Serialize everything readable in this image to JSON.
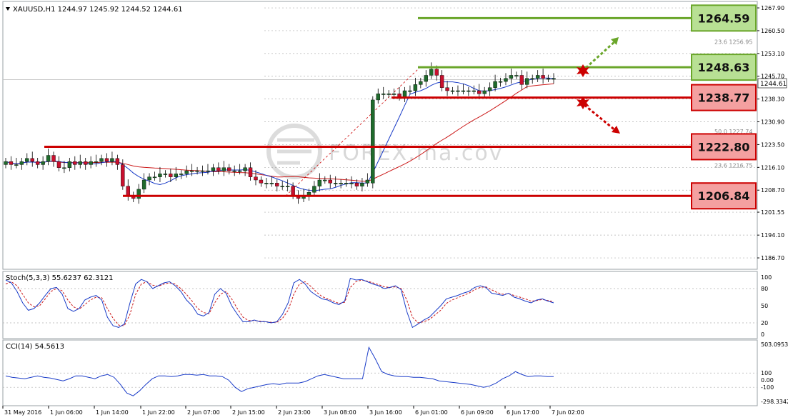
{
  "main_header": "XAUUSD,H1  1244.97 1245.92 1244.52 1244.61",
  "stoch_header": "Stoch(5,3,3) 55.6237 62.3121",
  "cci_header": "CCI(14) 54.5613",
  "watermark": "FOREX.ma.cov",
  "colors": {
    "support": "#cc0000",
    "resistance": "#6aa62a",
    "support_box": "#f4a0a0",
    "resistance_box": "#b8e094",
    "bull_candle": "#1f6b2c",
    "bear_candle": "#c8102e",
    "ma_fast": "#1a3cc8",
    "ma_slow": "#cc1a1a"
  },
  "chart_data": [
    {
      "type": "candlestick",
      "symbol": "XAUUSD",
      "timeframe": "H1",
      "ohlc_last": {
        "open": 1244.97,
        "high": 1245.92,
        "low": 1244.52,
        "close": 1244.61
      },
      "current_price": "1244.61",
      "ylim": [
        1183.0,
        1270.0
      ],
      "y_ticks": [
        "1267.90",
        "1260.50",
        "1253.10",
        "1245.70",
        "1238.30",
        "1230.90",
        "1223.50",
        "1216.10",
        "1208.70",
        "1201.55",
        "1194.10",
        "1186.70"
      ],
      "x_ticks": [
        "31 May 2016",
        "1 Jun 06:00",
        "1 Jun 14:00",
        "1 Jun 22:00",
        "2 Jun 07:00",
        "2 Jun 15:00",
        "2 Jun 23:00",
        "3 Jun 08:00",
        "3 Jun 16:00",
        "6 Jun 01:00",
        "6 Jun 09:00",
        "6 Jun 17:00",
        "7 Jun 02:00"
      ],
      "levels": [
        {
          "label": "1264.59",
          "value": 1264.59,
          "kind": "resistance"
        },
        {
          "label": "1248.63",
          "value": 1248.63,
          "kind": "resistance"
        },
        {
          "label": "1238.77",
          "value": 1238.77,
          "kind": "support"
        },
        {
          "label": "1222.80",
          "value": 1222.8,
          "kind": "support"
        },
        {
          "label": "1206.84",
          "value": 1206.84,
          "kind": "support"
        }
      ],
      "fibo_labels": [
        "23.6  1256.95",
        "50.0  1227.74",
        "23.6  1216.75"
      ],
      "closes": [
        1218,
        1217,
        1217,
        1218,
        1219,
        1218,
        1217,
        1218,
        1220,
        1218,
        1216,
        1216,
        1218,
        1217,
        1218,
        1217,
        1218,
        1218,
        1219,
        1218,
        1219,
        1217,
        1210,
        1207,
        1206,
        1209,
        1212,
        1213,
        1213,
        1214,
        1214,
        1213,
        1214,
        1214,
        1215,
        1215,
        1215,
        1215,
        1215,
        1216,
        1215,
        1216,
        1215,
        1215,
        1215,
        1216,
        1213,
        1212,
        1211,
        1211,
        1211,
        1210,
        1210,
        1210,
        1207,
        1206,
        1207,
        1208,
        1210,
        1212,
        1212,
        1211,
        1211,
        1211,
        1211,
        1211,
        1210,
        1211,
        1212,
        1238,
        1240,
        1240,
        1240,
        1240,
        1239,
        1241,
        1241,
        1243,
        1244,
        1246,
        1248,
        1246,
        1242,
        1241,
        1241,
        1241,
        1241,
        1241,
        1241,
        1240,
        1241,
        1242,
        1244,
        1244,
        1245,
        1246,
        1246,
        1243,
        1245,
        1245,
        1246,
        1245,
        1245,
        1245
      ]
    },
    {
      "type": "line",
      "title": "Stoch(5,3,3) 55.6237 62.3121",
      "y_ticks": [
        "100",
        "80",
        "50",
        "20",
        "0"
      ],
      "ylim": [
        0,
        100
      ],
      "series": [
        {
          "values": [
            95,
            90,
            75,
            55,
            42,
            45,
            55,
            68,
            80,
            82,
            70,
            45,
            40,
            45,
            60,
            65,
            68,
            60,
            30,
            15,
            12,
            18,
            55,
            88,
            96,
            92,
            80,
            85,
            90,
            92,
            85,
            75,
            60,
            50,
            35,
            32,
            38,
            70,
            80,
            72,
            50,
            35,
            22,
            22,
            25,
            22,
            22,
            20,
            22,
            35,
            55,
            90,
            96,
            88,
            75,
            68,
            62,
            60,
            55,
            52,
            58,
            98,
            95,
            96,
            92,
            88,
            85,
            80,
            82,
            85,
            78,
            40,
            12,
            18,
            25,
            30,
            40,
            50,
            62,
            65,
            68,
            72,
            75,
            82,
            85,
            82,
            72,
            70,
            68,
            72,
            65,
            62,
            58,
            55,
            60,
            62,
            58,
            55
          ]
        },
        {
          "values": [
            88,
            92,
            85,
            70,
            55,
            48,
            50,
            62,
            75,
            80,
            76,
            60,
            48,
            44,
            52,
            60,
            65,
            64,
            45,
            28,
            16,
            15,
            35,
            70,
            88,
            92,
            86,
            84,
            88,
            90,
            88,
            80,
            70,
            58,
            45,
            38,
            36,
            55,
            70,
            75,
            62,
            45,
            30,
            24,
            24,
            23,
            22,
            21,
            21,
            28,
            42,
            70,
            88,
            92,
            84,
            74,
            66,
            62,
            58,
            54,
            56,
            82,
            92,
            95,
            93,
            90,
            87,
            83,
            82,
            83,
            80,
            60,
            30,
            20,
            22,
            26,
            34,
            42,
            54,
            60,
            64,
            68,
            72,
            78,
            82,
            83,
            78,
            73,
            70,
            71,
            68,
            65,
            62,
            58,
            59,
            61,
            59,
            57
          ]
        }
      ]
    },
    {
      "type": "line",
      "title": "CCI(14) 54.5613",
      "y_ticks": [
        "503.0953",
        "100",
        "0.00",
        "-100",
        "-298.3342"
      ],
      "ylim": [
        -298.3342,
        503.0953
      ],
      "series": [
        {
          "values": [
            60,
            40,
            30,
            20,
            40,
            60,
            40,
            30,
            10,
            -10,
            20,
            60,
            60,
            40,
            20,
            60,
            80,
            40,
            -60,
            -180,
            -220,
            -150,
            -60,
            20,
            60,
            60,
            50,
            60,
            80,
            80,
            70,
            80,
            60,
            60,
            50,
            0,
            -100,
            -160,
            -120,
            -100,
            -80,
            -60,
            -50,
            -60,
            -40,
            -40,
            -40,
            -20,
            20,
            60,
            80,
            60,
            40,
            20,
            20,
            20,
            20,
            460,
            300,
            120,
            80,
            60,
            50,
            50,
            40,
            40,
            30,
            20,
            -10,
            -20,
            -30,
            -40,
            -50,
            -60,
            -80,
            -100,
            -80,
            -40,
            20,
            60,
            120,
            80,
            50,
            60,
            60,
            50,
            50
          ]
        }
      ]
    }
  ]
}
